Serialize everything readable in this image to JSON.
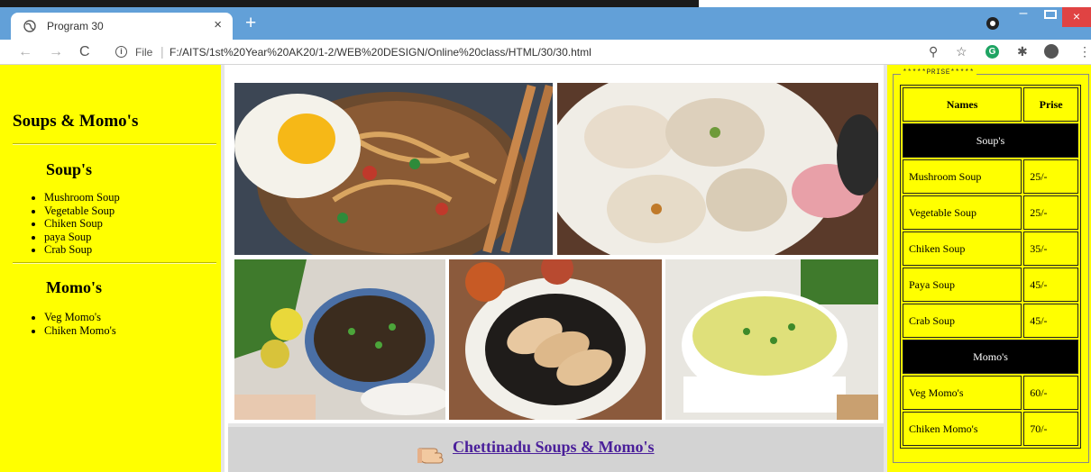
{
  "browser": {
    "tab_title": "Program 30",
    "tab_close": "×",
    "new_tab": "+",
    "nav_back": "←",
    "nav_forward": "→",
    "nav_reload": "C",
    "info_icon": "i",
    "url_scheme_label": "File",
    "url_separator": "|",
    "url": "F:/AITS/1st%20Year%20AK20/1-2/WEB%20DESIGN/Online%20class/HTML/30/30.html",
    "zoom_icon": "⚲",
    "star_icon": "☆",
    "ext_g_label": "G",
    "puzzle_icon": "✱",
    "menu_icon": "⋮",
    "window_min": "–",
    "window_close": "×"
  },
  "left_frame": {
    "heading": "Soups & Momo's",
    "soups_heading": "Soup's",
    "soups": [
      "Mushroom Soup",
      "Vegetable Soup",
      "Chiken Soup",
      "paya Soup",
      "Crab Soup"
    ],
    "momos_heading": "Momo's",
    "momos": [
      "Veg Momo's",
      "Chiken Momo's"
    ]
  },
  "main_frame": {
    "link_text": "Chettinadu Soups & Momo's",
    "photos": [
      "noodles-photo",
      "momos-plate-photo",
      "herb-soup-photo",
      "fried-momos-photo",
      "creamy-soup-photo"
    ]
  },
  "price_panel": {
    "legend": "*****PRISE*****",
    "header_name": "Names",
    "header_price": "Prise",
    "groups": [
      {
        "category": "Soup's",
        "items": [
          {
            "name": "Mushroom Soup",
            "price": "25/-"
          },
          {
            "name": "Vegetable Soup",
            "price": "25/-"
          },
          {
            "name": "Chiken Soup",
            "price": "35/-"
          },
          {
            "name": "Paya Soup",
            "price": "45/-"
          },
          {
            "name": "Crab Soup",
            "price": "45/-"
          }
        ]
      },
      {
        "category": "Momo's",
        "items": [
          {
            "name": "Veg Momo's",
            "price": "60/-"
          },
          {
            "name": "Chiken Momo's",
            "price": "70/-"
          }
        ]
      }
    ]
  },
  "colors": {
    "frame_background": "#ffff00",
    "titlebar": "#62a0d8",
    "category_row": "#000000",
    "link": "#4a1f9a",
    "footer_bar": "#d3d3d3"
  }
}
